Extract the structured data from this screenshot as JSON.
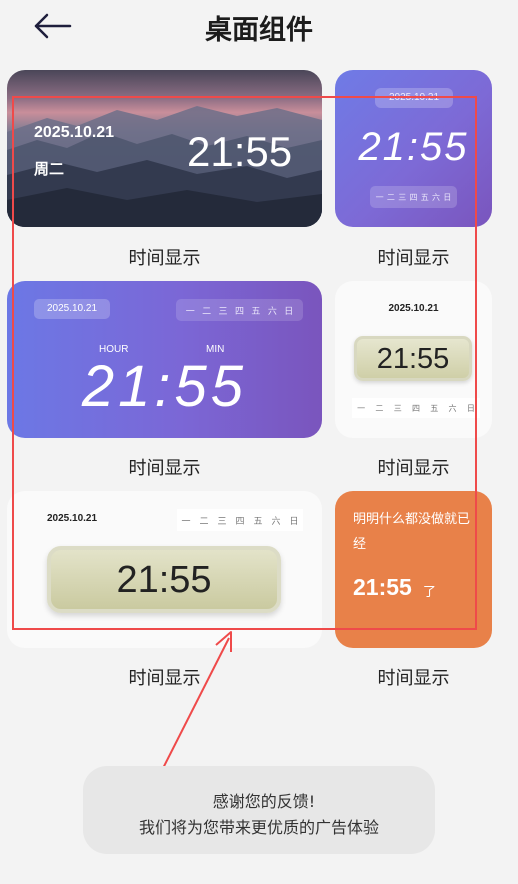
{
  "header": {
    "title": "桌面组件",
    "back_icon": "arrow-left-icon"
  },
  "widgets": [
    {
      "date": "2025.10.21",
      "weekday": "周二",
      "time": "21:55",
      "caption": "时间显示"
    },
    {
      "date": "2025.10.21",
      "time": "21:55",
      "week_labels": [
        "一",
        "二",
        "三",
        "四",
        "五",
        "六",
        "日"
      ],
      "caption": "时间显示"
    },
    {
      "date": "2025.10.21",
      "hour_label": "HOUR",
      "min_label": "MIN",
      "time": "21:55",
      "week_labels": [
        "一",
        "二",
        "三",
        "四",
        "五",
        "六",
        "日"
      ],
      "caption": "时间显示"
    },
    {
      "date": "2025.10.21",
      "time": "21:55",
      "week_labels": [
        "一",
        "二",
        "三",
        "四",
        "五",
        "六",
        "日"
      ],
      "caption": "时间显示"
    },
    {
      "date": "2025.10.21",
      "time": "21:55",
      "week_labels": [
        "一",
        "二",
        "三",
        "四",
        "五",
        "六",
        "日"
      ],
      "caption": "时间显示"
    },
    {
      "text": "明明什么都没做就已经",
      "time": "21:55",
      "suffix": "了",
      "caption": "时间显示"
    }
  ],
  "toast": {
    "line1": "感谢您的反馈!",
    "line2": "我们将为您带来更优质的广告体验"
  },
  "colors": {
    "annotation_red": "#ef4a4a",
    "orange_widget": "#e88149",
    "purple_widget": "#7b67d6"
  }
}
